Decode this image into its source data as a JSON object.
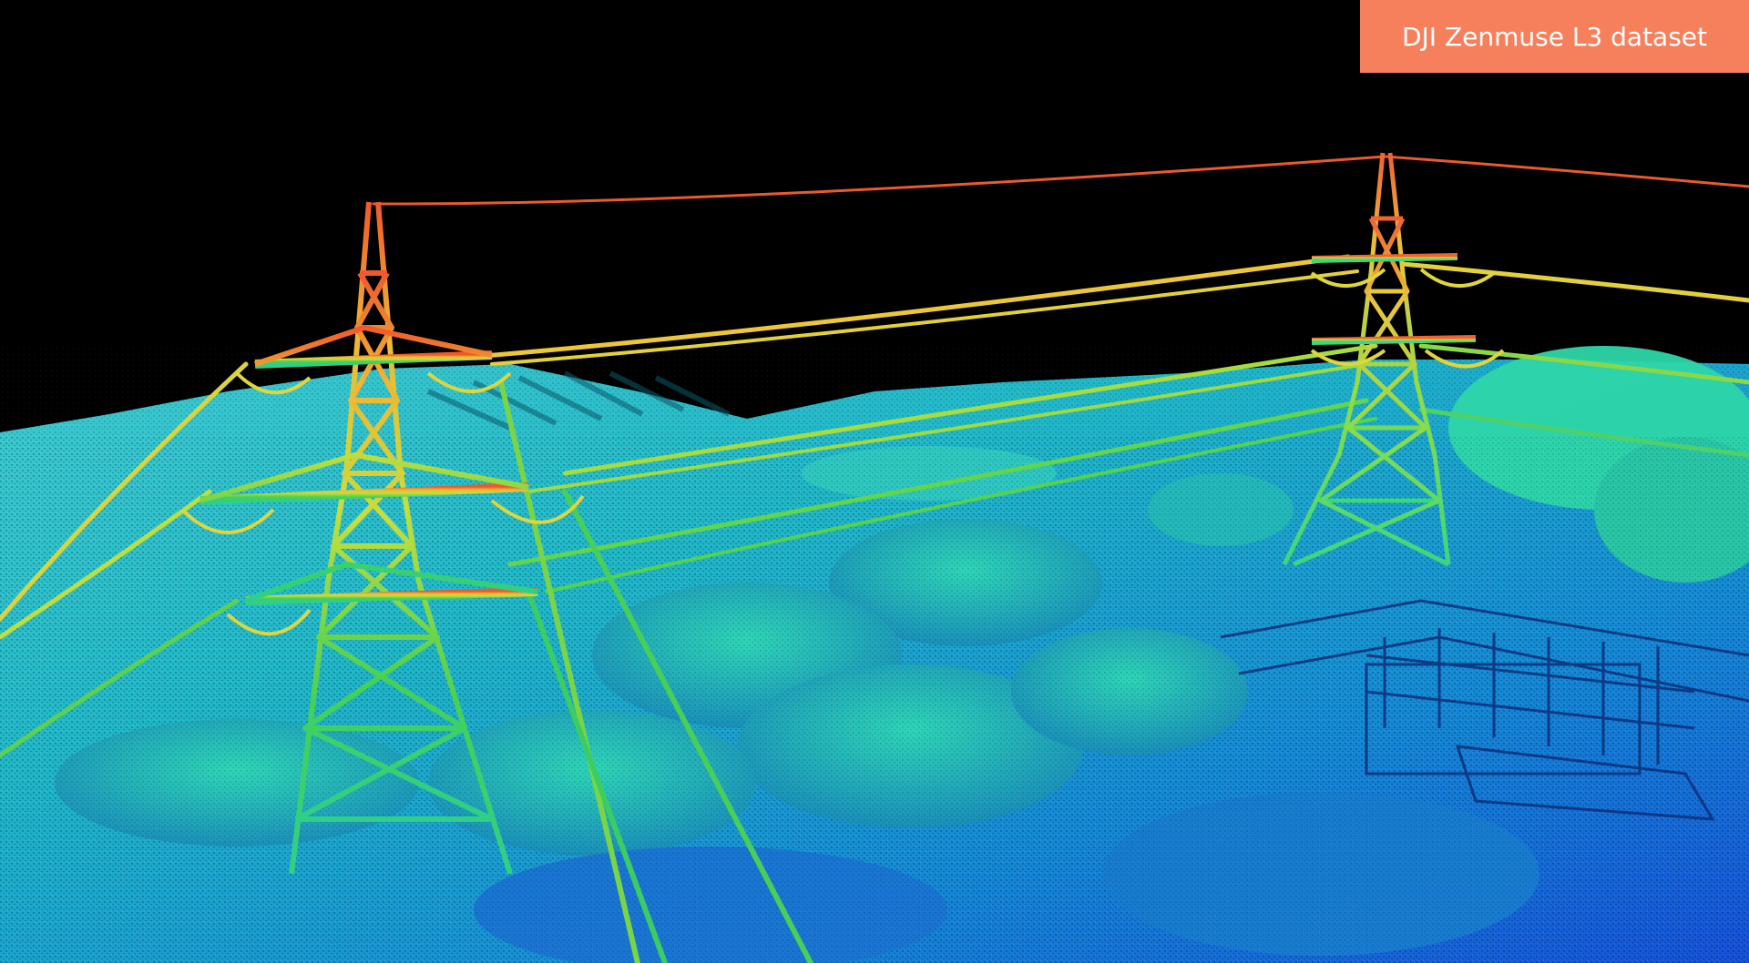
{
  "badge": {
    "text": "DJI Zenmuse L3 dataset",
    "background": "#F7805C",
    "color": "#FFFFFF"
  },
  "scene": {
    "description_colors": {
      "low": "#1F5BD8",
      "mid": "#19C2A8",
      "high": "#E7E13A",
      "top": "#F0622E"
    }
  }
}
